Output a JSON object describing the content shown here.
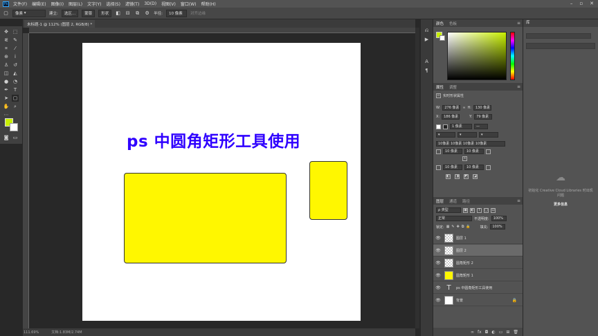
{
  "menubar": {
    "logo": "Ps",
    "items": [
      "文件(F)",
      "编辑(E)",
      "图像(I)",
      "图层(L)",
      "文字(Y)",
      "选择(S)",
      "滤镜(T)",
      "3D(D)",
      "视图(V)",
      "窗口(W)",
      "帮助(H)"
    ]
  },
  "options": {
    "shape_mode": "像素",
    "new_label": "建立:",
    "selection_btn": "选区...",
    "mask_btn": "蒙版",
    "shape_btn": "形状",
    "radius_label": "半径:",
    "radius_value": "10 像素",
    "align_edges": "对齐边缘"
  },
  "document": {
    "tab_title": "未标题-1 @ 112% (图层 2, RGB/8) *",
    "heading_text": "ps 中圆角矩形工具使用",
    "shape_fill": "#fff700",
    "text_color": "#2f00ff"
  },
  "status": {
    "zoom": "111.69%",
    "doc_size": "文档:1.83M/2.74M"
  },
  "color_panel": {
    "tabs": [
      "颜色",
      "色板"
    ],
    "foreground": "#c8f000",
    "background": "#ffffff"
  },
  "properties_panel": {
    "tabs": [
      "属性",
      "调整"
    ],
    "title": "实时形状属性",
    "w_label": "W:",
    "w_value": "276 像素",
    "h_label": "H:",
    "h_value": "130 像素",
    "x_label": "X:",
    "x_value": "186 像素",
    "y_label": "Y:",
    "y_value": "79 像素",
    "stroke_value": "1 像素",
    "corners_all": "10像素 10像素 10像素 10像素",
    "corner_tl": "10 像素",
    "corner_tr": "10 像素",
    "corner_bl": "10 像素",
    "corner_br": "10 像素"
  },
  "layers_panel": {
    "tabs": [
      "图层",
      "通道",
      "路径"
    ],
    "kind_filter": "ρ 类型",
    "blend_mode": "正常",
    "opacity_label": "不透明度:",
    "opacity_value": "100%",
    "lock_label": "锁定:",
    "fill_label": "填充:",
    "fill_value": "100%",
    "layers": [
      {
        "name": "图层 1",
        "thumb": "transparent",
        "selected": false
      },
      {
        "name": "图层 2",
        "thumb": "transparent",
        "selected": true
      },
      {
        "name": "圆角矩形 2",
        "thumb": "transparent",
        "selected": false
      },
      {
        "name": "圆角矩形 1",
        "thumb": "yellow",
        "selected": false
      },
      {
        "name": "ps 中圆角矩形工具使用",
        "thumb": "text",
        "selected": false
      },
      {
        "name": "背景",
        "thumb": "white",
        "selected": false
      }
    ]
  },
  "libraries_panel": {
    "tab": "库",
    "message": "初始化 Creative Cloud Libraries 时出现问题",
    "more": "更多信息"
  }
}
